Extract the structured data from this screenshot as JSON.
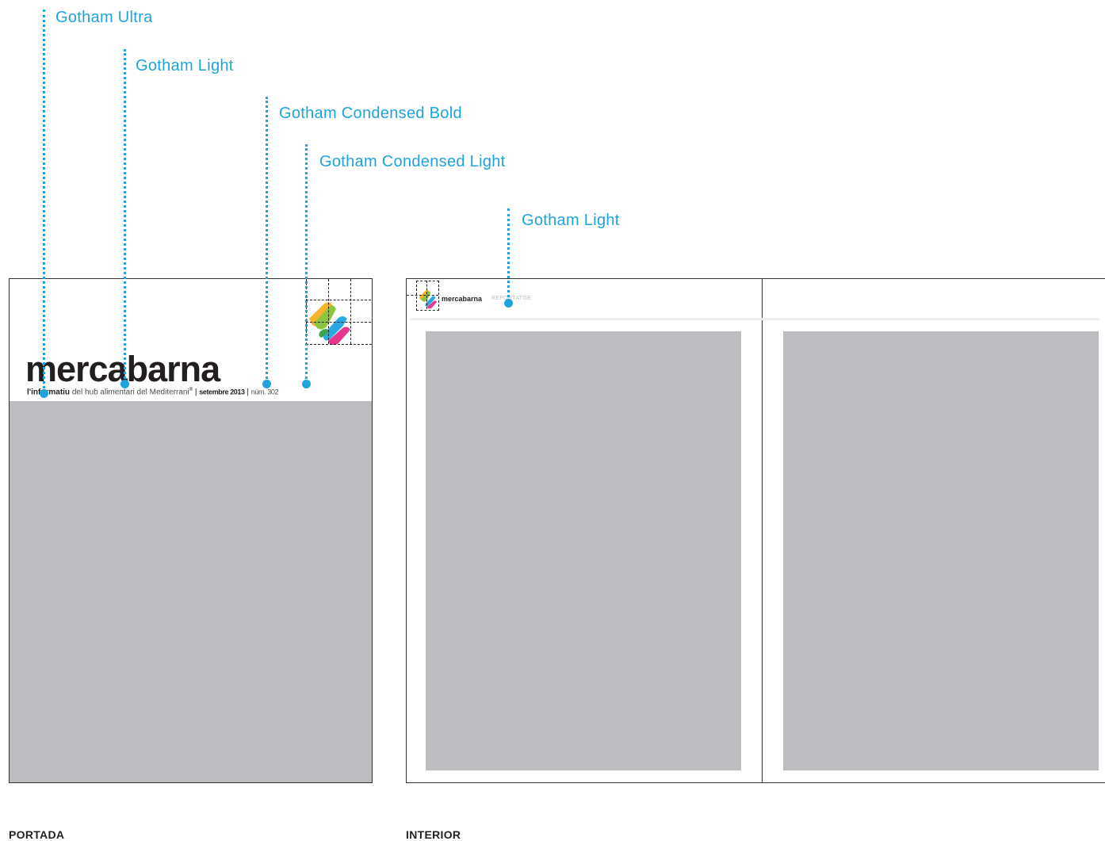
{
  "annotations": {
    "gotham_ultra": "Gotham Ultra",
    "gotham_light_1": "Gotham Light",
    "gotham_condensed_bold": "Gotham Condensed Bold",
    "gotham_condensed_light": "Gotham Condensed Light",
    "gotham_light_2": "Gotham Light"
  },
  "cover": {
    "brand": "mercabarna",
    "sub_bold": "l'informatiu",
    "sub_light": "del hub alimentari del Mediterrani",
    "sub_sup": "®",
    "separator": "|",
    "date": "setembre 2013",
    "issue": "núm. 302",
    "label": "PORTADA"
  },
  "interior": {
    "brand": "mercabarna",
    "section": "REPORTATGE",
    "label": "INTERIOR"
  },
  "colors": {
    "accent": "#1fa3dc",
    "placeholder": "#bcbdc1",
    "text": "#231f20"
  }
}
